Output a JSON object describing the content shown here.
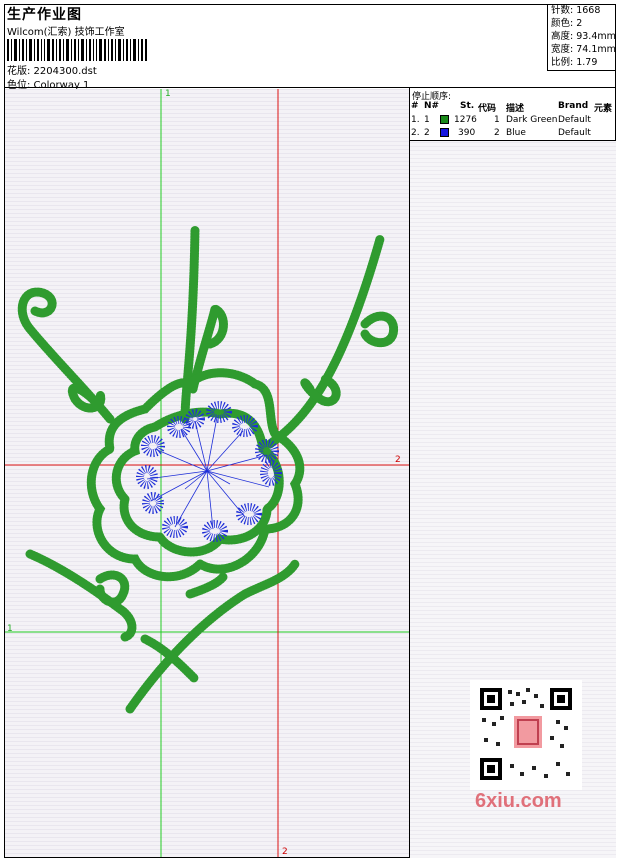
{
  "header": {
    "title": "生产作业图",
    "company": "Wilcom(汇索) 技饰工作室",
    "design_label": "花版: 2204300.dst",
    "colorway_label": "色位: Colorway 1"
  },
  "stats": {
    "stitches": "针数: 1668",
    "colors": "颜色: 2",
    "height": "高度: 93.4mm",
    "width": "宽度: 74.1mm",
    "scale": "比例: 1.79"
  },
  "stop_sequence": {
    "title": "停止顺序:",
    "headers": {
      "num": "#",
      "needle": "N#",
      "st": "St.",
      "code": "代码",
      "desc": "描述",
      "brand": "Brand",
      "element": "元素"
    },
    "rows": [
      {
        "num": "1.",
        "needle": "1",
        "color": "#1a8a1a",
        "st": "1276",
        "code": "1",
        "desc": "Dark Green",
        "brand": "Default"
      },
      {
        "num": "2.",
        "needle": "2",
        "color": "#1515e0",
        "st": "390",
        "code": "2",
        "desc": "Blue",
        "brand": "Default"
      }
    ]
  },
  "guides": {
    "label1": "1",
    "label2": "2"
  },
  "colors": {
    "green_stitch": "#2f9b2f",
    "blue_stitch": "#1f2fd8",
    "guide_green": "#22cc22",
    "guide_red": "#dd1111"
  },
  "watermark": "6xiu.com"
}
